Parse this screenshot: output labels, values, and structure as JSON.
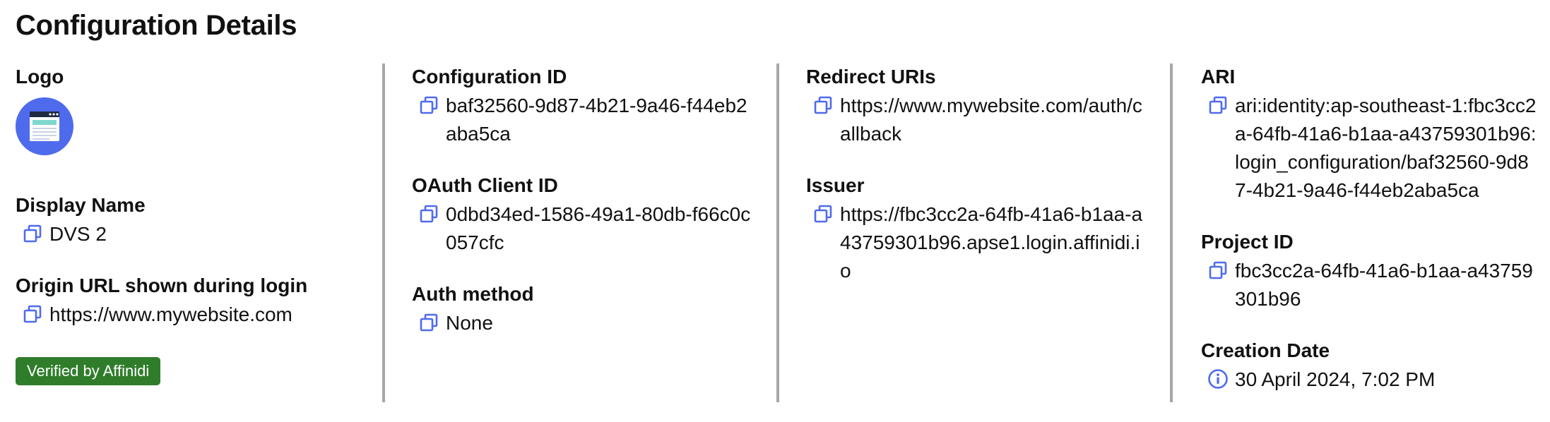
{
  "page": {
    "title": "Configuration Details"
  },
  "colors": {
    "accent": "#4f6bed",
    "badge": "#2f7d2b",
    "divider": "#a7a7a7"
  },
  "logo": {
    "label": "Logo",
    "icon": "browser-window-icon"
  },
  "display_name": {
    "label": "Display Name",
    "value": "DVS 2"
  },
  "origin_url": {
    "label": "Origin URL shown during login",
    "value": "https://www.mywebsite.com"
  },
  "badge": {
    "text": "Verified by Affinidi"
  },
  "configuration_id": {
    "label": "Configuration ID",
    "value": "baf32560-9d87-4b21-9a46-f44eb2aba5ca"
  },
  "oauth_client_id": {
    "label": "OAuth Client ID",
    "value": "0dbd34ed-1586-49a1-80db-f66c0c057cfc"
  },
  "auth_method": {
    "label": "Auth method",
    "value": "None"
  },
  "redirect_uris": {
    "label": "Redirect URIs",
    "value": "https://www.mywebsite.com/auth/callback"
  },
  "issuer": {
    "label": "Issuer",
    "value": "https://fbc3cc2a-64fb-41a6-b1aa-a43759301b96.apse1.login.affinidi.io"
  },
  "ari": {
    "label": "ARI",
    "value": "ari:identity:ap-southeast-1:fbc3cc2a-64fb-41a6-b1aa-a43759301b96:login_configuration/baf32560-9d87-4b21-9a46-f44eb2aba5ca"
  },
  "project_id": {
    "label": "Project ID",
    "value": "fbc3cc2a-64fb-41a6-b1aa-a43759301b96"
  },
  "creation_date": {
    "label": "Creation Date",
    "value": "30 April 2024, 7:02 PM"
  }
}
